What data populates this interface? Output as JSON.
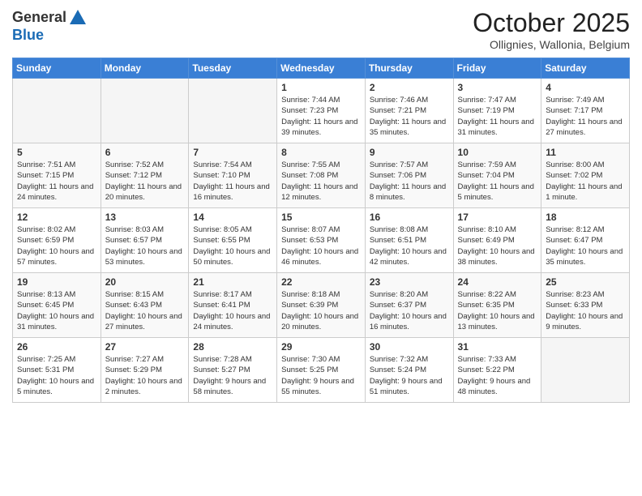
{
  "header": {
    "logo_general": "General",
    "logo_blue": "Blue",
    "month_title": "October 2025",
    "subtitle": "Ollignies, Wallonia, Belgium"
  },
  "days_of_week": [
    "Sunday",
    "Monday",
    "Tuesday",
    "Wednesday",
    "Thursday",
    "Friday",
    "Saturday"
  ],
  "weeks": [
    [
      {
        "day": "",
        "empty": true
      },
      {
        "day": "",
        "empty": true
      },
      {
        "day": "",
        "empty": true
      },
      {
        "day": "1",
        "sunrise": "Sunrise: 7:44 AM",
        "sunset": "Sunset: 7:23 PM",
        "daylight": "Daylight: 11 hours and 39 minutes."
      },
      {
        "day": "2",
        "sunrise": "Sunrise: 7:46 AM",
        "sunset": "Sunset: 7:21 PM",
        "daylight": "Daylight: 11 hours and 35 minutes."
      },
      {
        "day": "3",
        "sunrise": "Sunrise: 7:47 AM",
        "sunset": "Sunset: 7:19 PM",
        "daylight": "Daylight: 11 hours and 31 minutes."
      },
      {
        "day": "4",
        "sunrise": "Sunrise: 7:49 AM",
        "sunset": "Sunset: 7:17 PM",
        "daylight": "Daylight: 11 hours and 27 minutes."
      }
    ],
    [
      {
        "day": "5",
        "sunrise": "Sunrise: 7:51 AM",
        "sunset": "Sunset: 7:15 PM",
        "daylight": "Daylight: 11 hours and 24 minutes."
      },
      {
        "day": "6",
        "sunrise": "Sunrise: 7:52 AM",
        "sunset": "Sunset: 7:12 PM",
        "daylight": "Daylight: 11 hours and 20 minutes."
      },
      {
        "day": "7",
        "sunrise": "Sunrise: 7:54 AM",
        "sunset": "Sunset: 7:10 PM",
        "daylight": "Daylight: 11 hours and 16 minutes."
      },
      {
        "day": "8",
        "sunrise": "Sunrise: 7:55 AM",
        "sunset": "Sunset: 7:08 PM",
        "daylight": "Daylight: 11 hours and 12 minutes."
      },
      {
        "day": "9",
        "sunrise": "Sunrise: 7:57 AM",
        "sunset": "Sunset: 7:06 PM",
        "daylight": "Daylight: 11 hours and 8 minutes."
      },
      {
        "day": "10",
        "sunrise": "Sunrise: 7:59 AM",
        "sunset": "Sunset: 7:04 PM",
        "daylight": "Daylight: 11 hours and 5 minutes."
      },
      {
        "day": "11",
        "sunrise": "Sunrise: 8:00 AM",
        "sunset": "Sunset: 7:02 PM",
        "daylight": "Daylight: 11 hours and 1 minute."
      }
    ],
    [
      {
        "day": "12",
        "sunrise": "Sunrise: 8:02 AM",
        "sunset": "Sunset: 6:59 PM",
        "daylight": "Daylight: 10 hours and 57 minutes."
      },
      {
        "day": "13",
        "sunrise": "Sunrise: 8:03 AM",
        "sunset": "Sunset: 6:57 PM",
        "daylight": "Daylight: 10 hours and 53 minutes."
      },
      {
        "day": "14",
        "sunrise": "Sunrise: 8:05 AM",
        "sunset": "Sunset: 6:55 PM",
        "daylight": "Daylight: 10 hours and 50 minutes."
      },
      {
        "day": "15",
        "sunrise": "Sunrise: 8:07 AM",
        "sunset": "Sunset: 6:53 PM",
        "daylight": "Daylight: 10 hours and 46 minutes."
      },
      {
        "day": "16",
        "sunrise": "Sunrise: 8:08 AM",
        "sunset": "Sunset: 6:51 PM",
        "daylight": "Daylight: 10 hours and 42 minutes."
      },
      {
        "day": "17",
        "sunrise": "Sunrise: 8:10 AM",
        "sunset": "Sunset: 6:49 PM",
        "daylight": "Daylight: 10 hours and 38 minutes."
      },
      {
        "day": "18",
        "sunrise": "Sunrise: 8:12 AM",
        "sunset": "Sunset: 6:47 PM",
        "daylight": "Daylight: 10 hours and 35 minutes."
      }
    ],
    [
      {
        "day": "19",
        "sunrise": "Sunrise: 8:13 AM",
        "sunset": "Sunset: 6:45 PM",
        "daylight": "Daylight: 10 hours and 31 minutes."
      },
      {
        "day": "20",
        "sunrise": "Sunrise: 8:15 AM",
        "sunset": "Sunset: 6:43 PM",
        "daylight": "Daylight: 10 hours and 27 minutes."
      },
      {
        "day": "21",
        "sunrise": "Sunrise: 8:17 AM",
        "sunset": "Sunset: 6:41 PM",
        "daylight": "Daylight: 10 hours and 24 minutes."
      },
      {
        "day": "22",
        "sunrise": "Sunrise: 8:18 AM",
        "sunset": "Sunset: 6:39 PM",
        "daylight": "Daylight: 10 hours and 20 minutes."
      },
      {
        "day": "23",
        "sunrise": "Sunrise: 8:20 AM",
        "sunset": "Sunset: 6:37 PM",
        "daylight": "Daylight: 10 hours and 16 minutes."
      },
      {
        "day": "24",
        "sunrise": "Sunrise: 8:22 AM",
        "sunset": "Sunset: 6:35 PM",
        "daylight": "Daylight: 10 hours and 13 minutes."
      },
      {
        "day": "25",
        "sunrise": "Sunrise: 8:23 AM",
        "sunset": "Sunset: 6:33 PM",
        "daylight": "Daylight: 10 hours and 9 minutes."
      }
    ],
    [
      {
        "day": "26",
        "sunrise": "Sunrise: 7:25 AM",
        "sunset": "Sunset: 5:31 PM",
        "daylight": "Daylight: 10 hours and 5 minutes."
      },
      {
        "day": "27",
        "sunrise": "Sunrise: 7:27 AM",
        "sunset": "Sunset: 5:29 PM",
        "daylight": "Daylight: 10 hours and 2 minutes."
      },
      {
        "day": "28",
        "sunrise": "Sunrise: 7:28 AM",
        "sunset": "Sunset: 5:27 PM",
        "daylight": "Daylight: 9 hours and 58 minutes."
      },
      {
        "day": "29",
        "sunrise": "Sunrise: 7:30 AM",
        "sunset": "Sunset: 5:25 PM",
        "daylight": "Daylight: 9 hours and 55 minutes."
      },
      {
        "day": "30",
        "sunrise": "Sunrise: 7:32 AM",
        "sunset": "Sunset: 5:24 PM",
        "daylight": "Daylight: 9 hours and 51 minutes."
      },
      {
        "day": "31",
        "sunrise": "Sunrise: 7:33 AM",
        "sunset": "Sunset: 5:22 PM",
        "daylight": "Daylight: 9 hours and 48 minutes."
      },
      {
        "day": "",
        "empty": true
      }
    ]
  ]
}
